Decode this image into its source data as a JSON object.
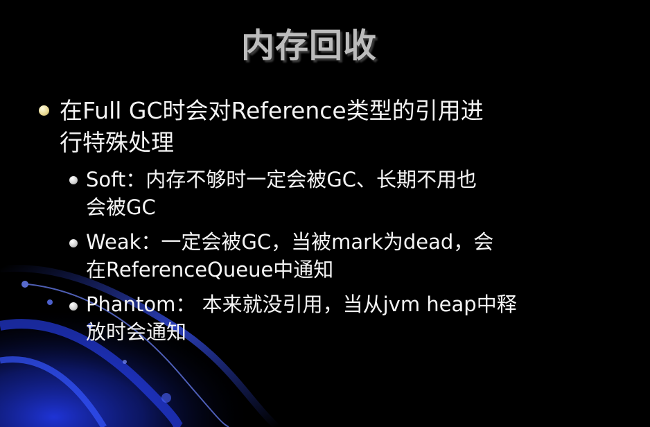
{
  "slide": {
    "title": "内存回收",
    "main_point": {
      "line1": "在Full GC时会对Reference类型的引用进",
      "line2": "行特殊处理"
    },
    "sub_points": [
      {
        "line1": " Soft：内存不够时一定会被GC、长期不用也",
        "line2": "会被GC"
      },
      {
        "line1": " Weak：一定会被GC，当被mark为dead，会",
        "line2": "在ReferenceQueue中通知"
      },
      {
        "line1": "Phantom： 本来就没引用，当从jvm heap中释",
        "line2": "放时会通知"
      }
    ],
    "colors": {
      "background": "#000000",
      "title": "#bcbcbc",
      "text": "#f4f4f4",
      "main_bullet": "#e8d890",
      "sub_bullet": "#cfcfcf",
      "decor_blue": "#1428b4"
    }
  }
}
